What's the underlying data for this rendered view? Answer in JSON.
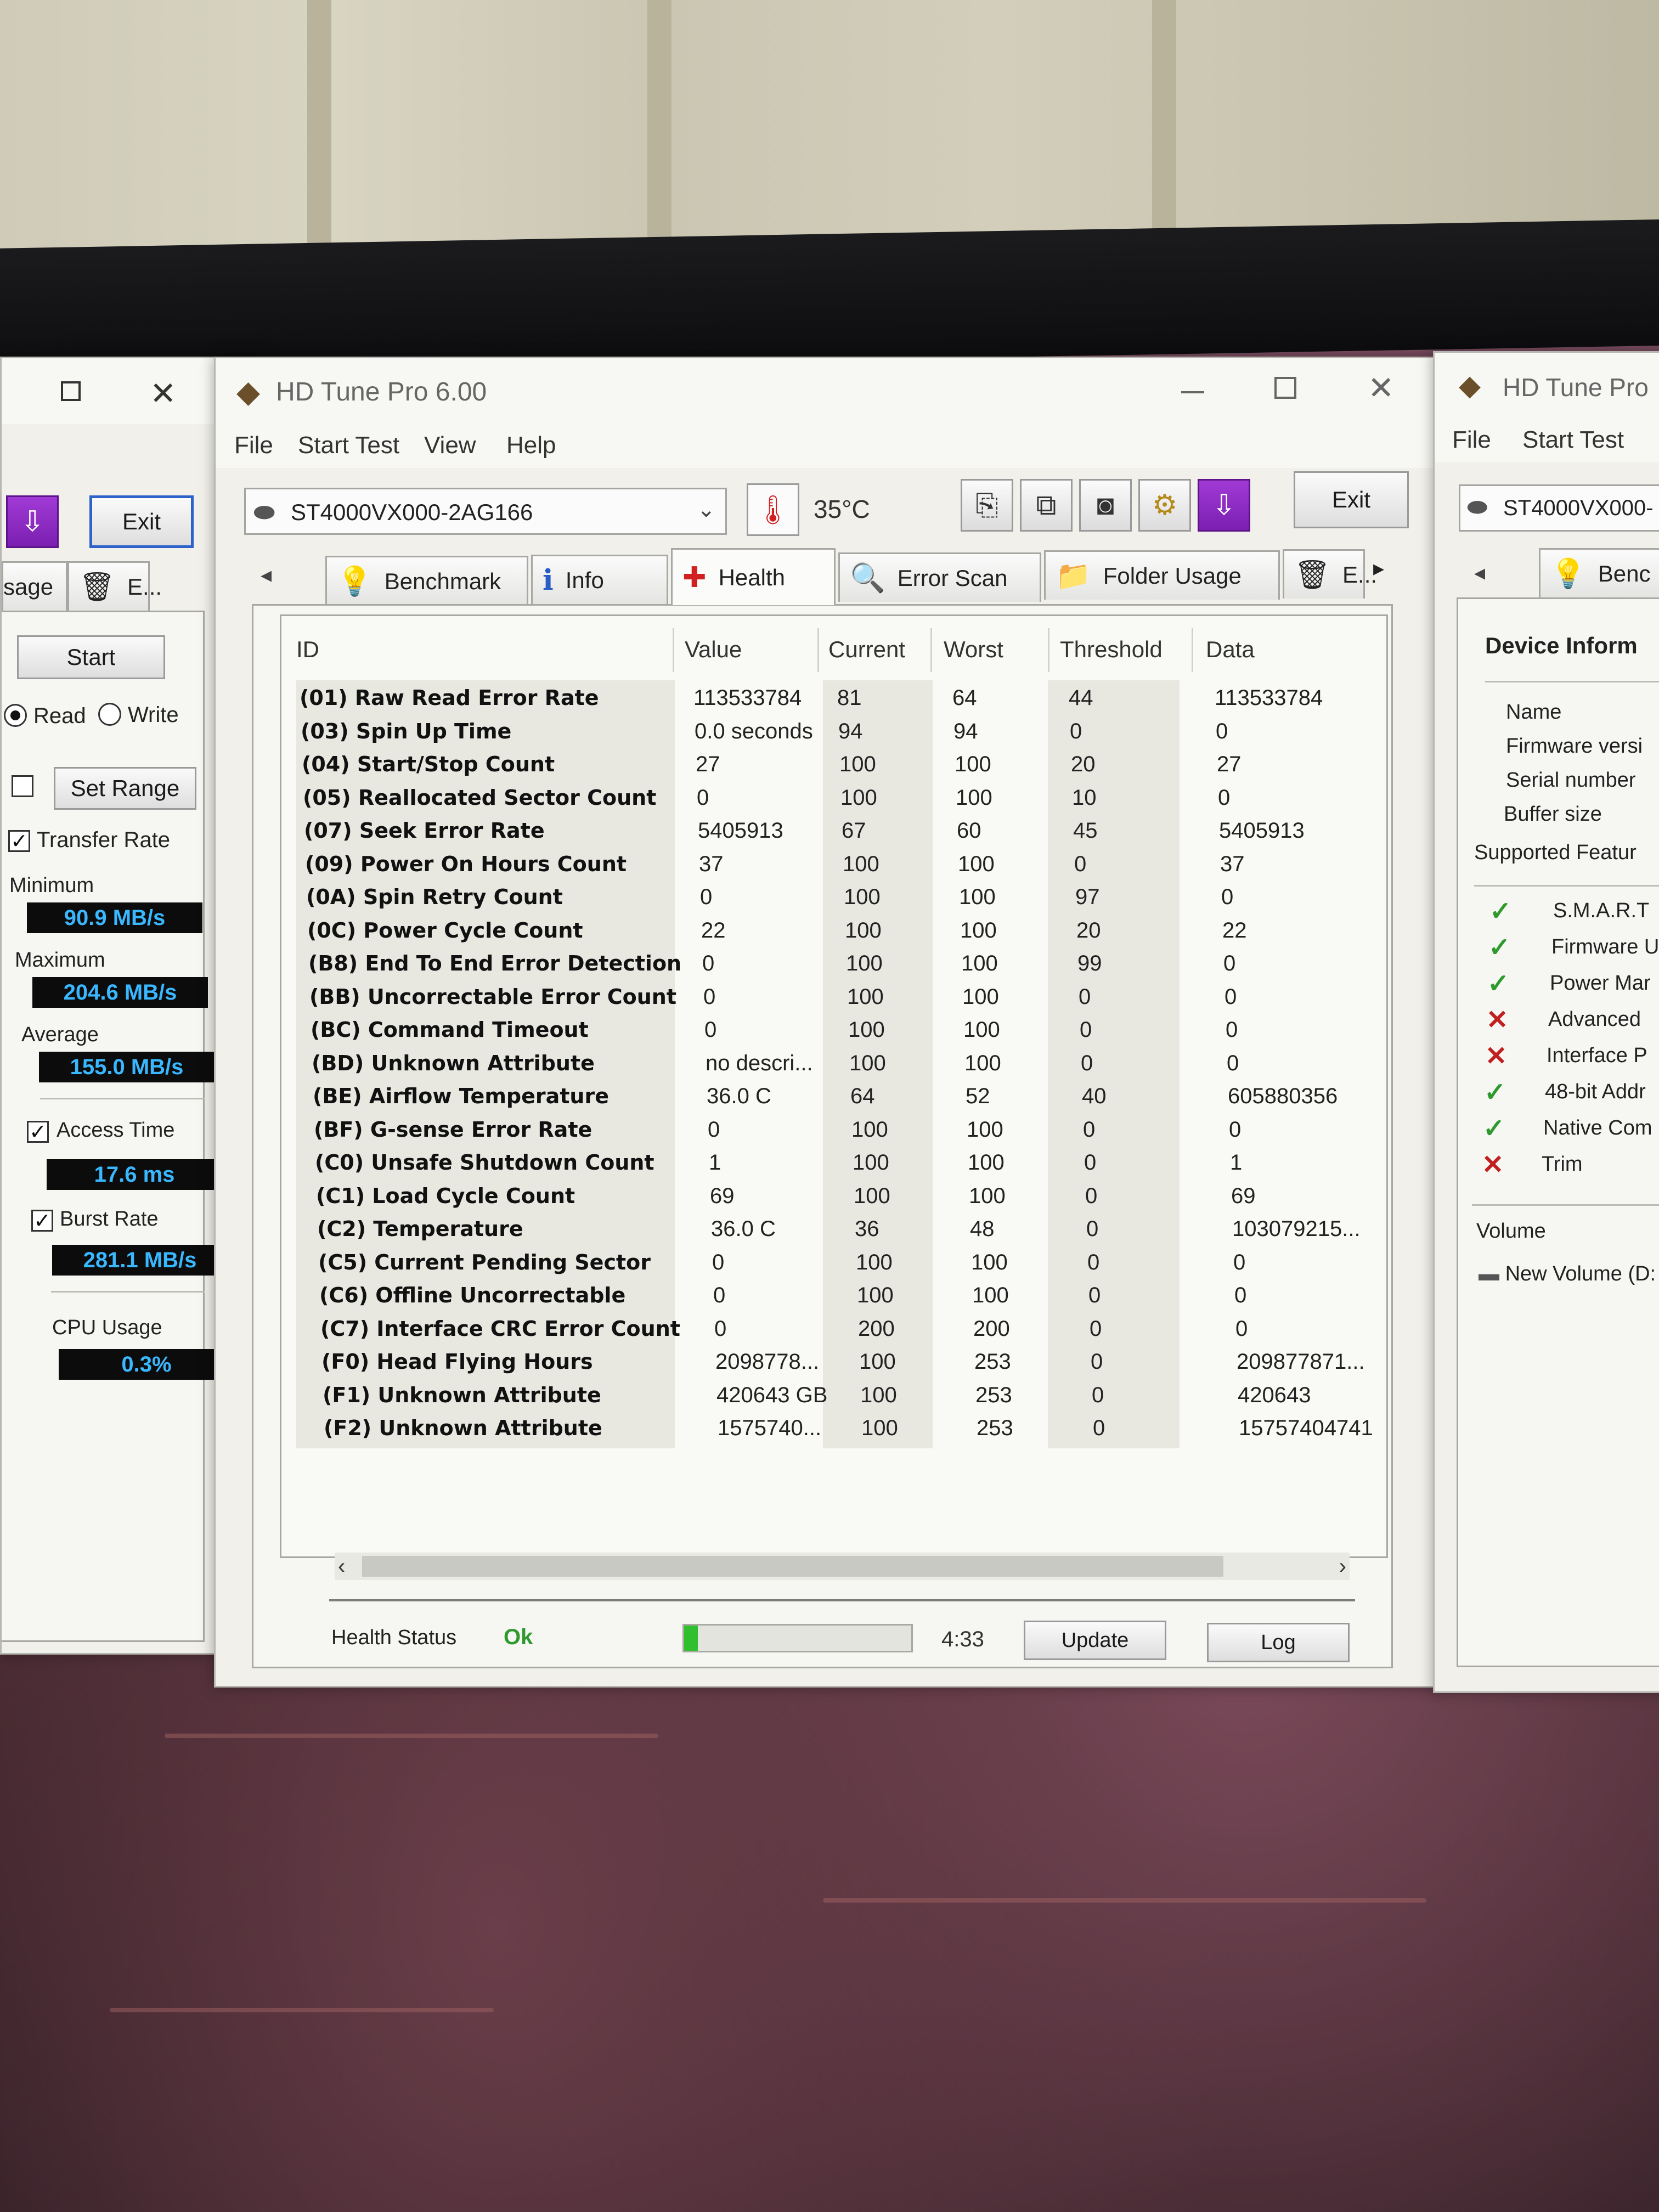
{
  "app": {
    "title": "HD Tune Pro 6.00",
    "title_right": "HD Tune Pro"
  },
  "menu": [
    "File",
    "Start Test",
    "View",
    "Help"
  ],
  "menu_right": [
    "File",
    "Start Test"
  ],
  "drive": {
    "name": "ST4000VX000-2AG166",
    "name_right": "ST4000VX000-",
    "temperature": "35°C"
  },
  "toolbar": {
    "icons": [
      "copy-text-icon",
      "copy-info-icon",
      "screenshot-icon",
      "options-icon",
      "download-icon"
    ],
    "exit_label": "Exit"
  },
  "tabs": [
    {
      "label": "Benchmark",
      "icon": "lightbulb-icon"
    },
    {
      "label": "Info",
      "icon": "info-icon"
    },
    {
      "label": "Health",
      "icon": "red-cross-icon"
    },
    {
      "label": "Error Scan",
      "icon": "magnifier-icon"
    },
    {
      "label": "Folder Usage",
      "icon": "folder-icon"
    },
    {
      "label": "E...",
      "icon": "trash-icon"
    }
  ],
  "health": {
    "columns": [
      "ID",
      "Value",
      "Current",
      "Worst",
      "Threshold",
      "Data"
    ],
    "rows": [
      [
        "(01) Raw Read Error Rate",
        "113533784",
        "81",
        "64",
        "44",
        "113533784"
      ],
      [
        "(03) Spin Up Time",
        "0.0 seconds",
        "94",
        "94",
        "0",
        "0"
      ],
      [
        "(04) Start/Stop Count",
        "27",
        "100",
        "100",
        "20",
        "27"
      ],
      [
        "(05) Reallocated Sector Count",
        "0",
        "100",
        "100",
        "10",
        "0"
      ],
      [
        "(07) Seek Error Rate",
        "5405913",
        "67",
        "60",
        "45",
        "5405913"
      ],
      [
        "(09) Power On Hours Count",
        "37",
        "100",
        "100",
        "0",
        "37"
      ],
      [
        "(0A) Spin Retry Count",
        "0",
        "100",
        "100",
        "97",
        "0"
      ],
      [
        "(0C) Power Cycle Count",
        "22",
        "100",
        "100",
        "20",
        "22"
      ],
      [
        "(B8) End To End Error Detection",
        "0",
        "100",
        "100",
        "99",
        "0"
      ],
      [
        "(BB) Uncorrectable Error Count",
        "0",
        "100",
        "100",
        "0",
        "0"
      ],
      [
        "(BC) Command Timeout",
        "0",
        "100",
        "100",
        "0",
        "0"
      ],
      [
        "(BD) Unknown Attribute",
        "no descri...",
        "100",
        "100",
        "0",
        "0"
      ],
      [
        "(BE) Airflow Temperature",
        "36.0 C",
        "64",
        "52",
        "40",
        "605880356"
      ],
      [
        "(BF) G-sense Error Rate",
        "0",
        "100",
        "100",
        "0",
        "0"
      ],
      [
        "(C0) Unsafe Shutdown Count",
        "1",
        "100",
        "100",
        "0",
        "1"
      ],
      [
        "(C1) Load Cycle Count",
        "69",
        "100",
        "100",
        "0",
        "69"
      ],
      [
        "(C2) Temperature",
        "36.0 C",
        "36",
        "48",
        "0",
        "103079215..."
      ],
      [
        "(C5) Current Pending Sector",
        "0",
        "100",
        "100",
        "0",
        "0"
      ],
      [
        "(C6) Offline Uncorrectable",
        "0",
        "100",
        "100",
        "0",
        "0"
      ],
      [
        "(C7) Interface CRC Error Count",
        "0",
        "200",
        "200",
        "0",
        "0"
      ],
      [
        "(F0) Head Flying Hours",
        "2098778...",
        "100",
        "253",
        "0",
        "209877871..."
      ],
      [
        "(F1) Unknown Attribute",
        "420643 GB",
        "100",
        "253",
        "0",
        "420643"
      ],
      [
        "(F2) Unknown Attribute",
        "1575740...",
        "100",
        "253",
        "0",
        "15757404741"
      ]
    ]
  },
  "status": {
    "label": "Health Status",
    "value": "Ok",
    "progress": 0.06,
    "time": "4:33",
    "update_label": "Update",
    "log_label": "Log"
  },
  "left_panel": {
    "exit_label": "Exit",
    "tab_partial": "sage",
    "tab_partial2": "E...",
    "start_label": "Start",
    "read_label": "Read",
    "write_label": "Write",
    "set_range_label": "Set Range",
    "transfer_rate_label": "Transfer Rate",
    "minimum_label": "Minimum",
    "minimum_value": "90.9 MB/s",
    "maximum_label": "Maximum",
    "maximum_value": "204.6 MB/s",
    "average_label": "Average",
    "average_value": "155.0 MB/s",
    "access_time_label": "Access Time",
    "access_time_value": "17.6 ms",
    "burst_rate_label": "Burst Rate",
    "burst_rate_value": "281.1 MB/s",
    "cpu_label": "CPU Usage",
    "cpu_value": "0.3%"
  },
  "right_panel": {
    "tab_partial": "Benc",
    "section_title": "Device Inform",
    "fields": [
      "Name",
      "Firmware versi",
      "Serial number",
      "Buffer size"
    ],
    "supported_label": "Supported Featur",
    "features": [
      {
        "label": "S.M.A.R.T",
        "ok": true
      },
      {
        "label": "Firmware U",
        "ok": true
      },
      {
        "label": "Power Mar",
        "ok": true
      },
      {
        "label": "Advanced",
        "ok": false
      },
      {
        "label": "Interface P",
        "ok": false
      },
      {
        "label": "48-bit Addr",
        "ok": true
      },
      {
        "label": "Native Com",
        "ok": true
      },
      {
        "label": "Trim",
        "ok": false
      }
    ],
    "volume_label": "Volume",
    "volume_item": "New Volume (D:"
  },
  "colors": {
    "accent": "#2c62c9",
    "readout_text": "#39b7ff",
    "ok_green": "#2e9a2e",
    "progress_green": "#2fbf2f"
  }
}
